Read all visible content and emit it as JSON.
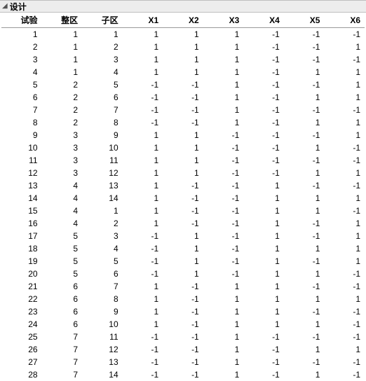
{
  "panel": {
    "title": "设计"
  },
  "table": {
    "headers": [
      "试验",
      "整区",
      "子区",
      "X1",
      "X2",
      "X3",
      "X4",
      "X5",
      "X6"
    ],
    "rows": [
      [
        1,
        1,
        1,
        1,
        1,
        1,
        -1,
        -1,
        -1
      ],
      [
        2,
        1,
        2,
        1,
        1,
        1,
        -1,
        -1,
        1
      ],
      [
        3,
        1,
        3,
        1,
        1,
        1,
        -1,
        -1,
        -1
      ],
      [
        4,
        1,
        4,
        1,
        1,
        1,
        -1,
        1,
        1
      ],
      [
        5,
        2,
        5,
        -1,
        -1,
        1,
        -1,
        -1,
        1
      ],
      [
        6,
        2,
        6,
        -1,
        -1,
        1,
        -1,
        1,
        1
      ],
      [
        7,
        2,
        7,
        -1,
        -1,
        1,
        -1,
        -1,
        -1
      ],
      [
        8,
        2,
        8,
        -1,
        -1,
        1,
        -1,
        1,
        1
      ],
      [
        9,
        3,
        9,
        1,
        1,
        -1,
        -1,
        -1,
        1
      ],
      [
        10,
        3,
        10,
        1,
        1,
        -1,
        -1,
        1,
        -1
      ],
      [
        11,
        3,
        11,
        1,
        1,
        -1,
        -1,
        -1,
        -1
      ],
      [
        12,
        3,
        12,
        1,
        1,
        -1,
        -1,
        1,
        1
      ],
      [
        13,
        4,
        13,
        1,
        -1,
        -1,
        1,
        -1,
        -1
      ],
      [
        14,
        4,
        14,
        1,
        -1,
        -1,
        1,
        1,
        1
      ],
      [
        15,
        4,
        1,
        1,
        -1,
        -1,
        1,
        1,
        -1
      ],
      [
        16,
        4,
        2,
        1,
        -1,
        -1,
        1,
        -1,
        1
      ],
      [
        17,
        5,
        3,
        -1,
        1,
        -1,
        1,
        -1,
        1
      ],
      [
        18,
        5,
        4,
        -1,
        1,
        -1,
        1,
        1,
        1
      ],
      [
        19,
        5,
        5,
        -1,
        1,
        -1,
        1,
        -1,
        1
      ],
      [
        20,
        5,
        6,
        -1,
        1,
        -1,
        1,
        1,
        -1
      ],
      [
        21,
        6,
        7,
        1,
        -1,
        1,
        1,
        -1,
        -1
      ],
      [
        22,
        6,
        8,
        1,
        -1,
        1,
        1,
        1,
        1
      ],
      [
        23,
        6,
        9,
        1,
        -1,
        1,
        1,
        -1,
        -1
      ],
      [
        24,
        6,
        10,
        1,
        -1,
        1,
        1,
        1,
        -1
      ],
      [
        25,
        7,
        11,
        -1,
        -1,
        1,
        -1,
        -1,
        -1
      ],
      [
        26,
        7,
        12,
        -1,
        -1,
        1,
        -1,
        1,
        1
      ],
      [
        27,
        7,
        13,
        -1,
        -1,
        1,
        -1,
        -1,
        -1
      ],
      [
        28,
        7,
        14,
        -1,
        -1,
        1,
        -1,
        1,
        -1
      ]
    ]
  }
}
